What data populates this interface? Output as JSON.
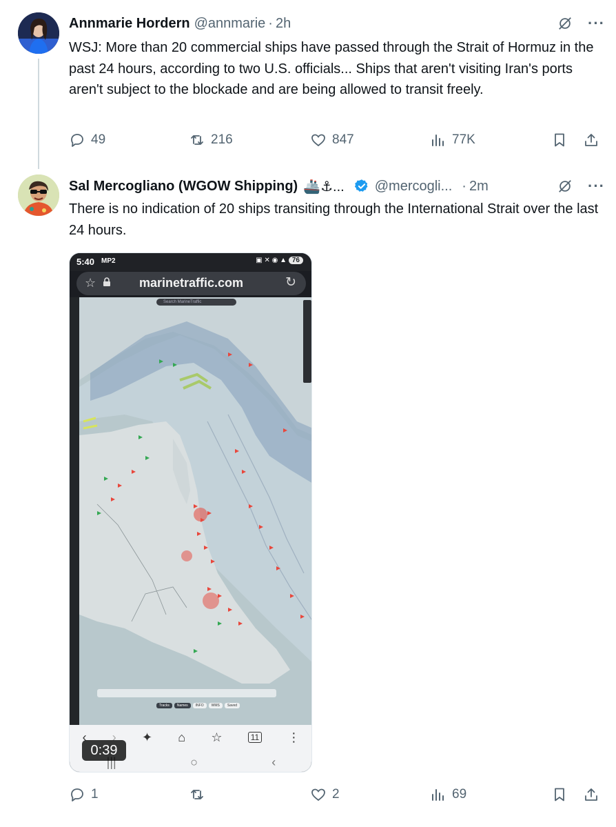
{
  "tweet1": {
    "name": "Annmarie Hordern",
    "handle": "@annmarie",
    "time": "2h",
    "text": "WSJ: More than 20 commercial ships have passed through the Strait of Hormuz in the past 24 hours, according to two U.S. officials... Ships that aren't visiting Iran's ports aren't subject to the blockade and are being allowed to transit freely.",
    "replies": "49",
    "reposts": "216",
    "likes": "847",
    "views": "77K"
  },
  "tweet2": {
    "name": "Sal Mercogliano (WGOW Shipping)",
    "emoji": "🚢⚓...",
    "handle": "@mercogli...",
    "time": "2m",
    "text": "There is no indication of 20 ships transiting through the International Strait over the last 24 hours.",
    "replies": "1",
    "reposts": "",
    "likes": "2",
    "views": "69",
    "media": {
      "status_time": "5:40",
      "carrier": "MP2",
      "battery": "76",
      "url": "marinetraffic.com",
      "map_search_placeholder": "Search MarineTraffic",
      "chip_tracks": "Tracks",
      "chip_names": "Names",
      "chip_info": "INFO",
      "chip_wms": "WMS",
      "chip_saved": "Saved",
      "duration": "0:39"
    }
  },
  "colors": {
    "text_primary": "#0f1419",
    "text_secondary": "#536471",
    "verified_blue": "#1d9bf0",
    "map_water": "#b8c8cc",
    "map_land": "#d9dfe0",
    "ship_red": "#e8473c",
    "ship_green": "#34a853"
  }
}
